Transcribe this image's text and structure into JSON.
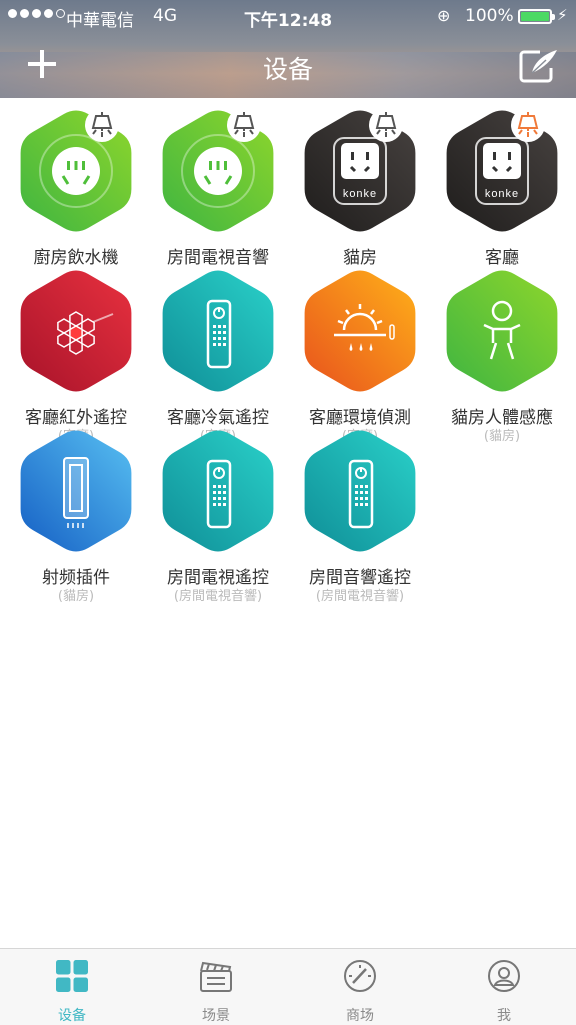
{
  "status_bar": {
    "carrier": "中華電信",
    "network": "4G",
    "time": "下午12:48",
    "battery": "100%"
  },
  "nav": {
    "title": "设备"
  },
  "devices": [
    {
      "name": "廚房飲水機",
      "room": "",
      "type": "socket",
      "color": "green"
    },
    {
      "name": "房間電視音響",
      "room": "",
      "type": "socket",
      "color": "green"
    },
    {
      "name": "貓房",
      "room": "",
      "type": "konke-socket",
      "color": "black",
      "brand": "KONKE"
    },
    {
      "name": "客廳",
      "room": "",
      "type": "konke-socket",
      "color": "black",
      "brand": "KONKE",
      "light_on": true
    },
    {
      "name": "客廳紅外遙控",
      "room": "(客廳)",
      "type": "ir-hub",
      "color": "red"
    },
    {
      "name": "客廳冷氣遙控",
      "room": "(客廳)",
      "type": "remote",
      "color": "teal"
    },
    {
      "name": "客廳環境偵測",
      "room": "(客廳)",
      "type": "environment",
      "color": "orange"
    },
    {
      "name": "貓房人體感應",
      "room": "(貓房)",
      "type": "motion",
      "color": "green"
    },
    {
      "name": "射频插件",
      "room": "(貓房)",
      "type": "rf-plugin",
      "color": "blue"
    },
    {
      "name": "房間電視遙控",
      "room": "(房間電視音響)",
      "type": "remote",
      "color": "teal"
    },
    {
      "name": "房間音響遙控",
      "room": "(房間電視音響)",
      "type": "remote",
      "color": "teal"
    }
  ],
  "tabs": [
    {
      "label": "设备",
      "icon": "grid-icon",
      "active": true
    },
    {
      "label": "场景",
      "icon": "clapperboard-icon",
      "active": false
    },
    {
      "label": "商场",
      "icon": "compass-icon",
      "active": false
    },
    {
      "label": "我",
      "icon": "profile-icon",
      "active": false
    }
  ],
  "colors": {
    "green": [
      "#8ed62c",
      "#3fb541"
    ],
    "black": [
      "#474240",
      "#1f1d1c"
    ],
    "red": [
      "#e8313f",
      "#a8132a"
    ],
    "teal": [
      "#2ad1c9",
      "#0f8e97"
    ],
    "orange": [
      "#ffb11a",
      "#e8521c"
    ],
    "blue": [
      "#58c0f2",
      "#155fc4"
    ],
    "accent": "#41b8c4"
  }
}
